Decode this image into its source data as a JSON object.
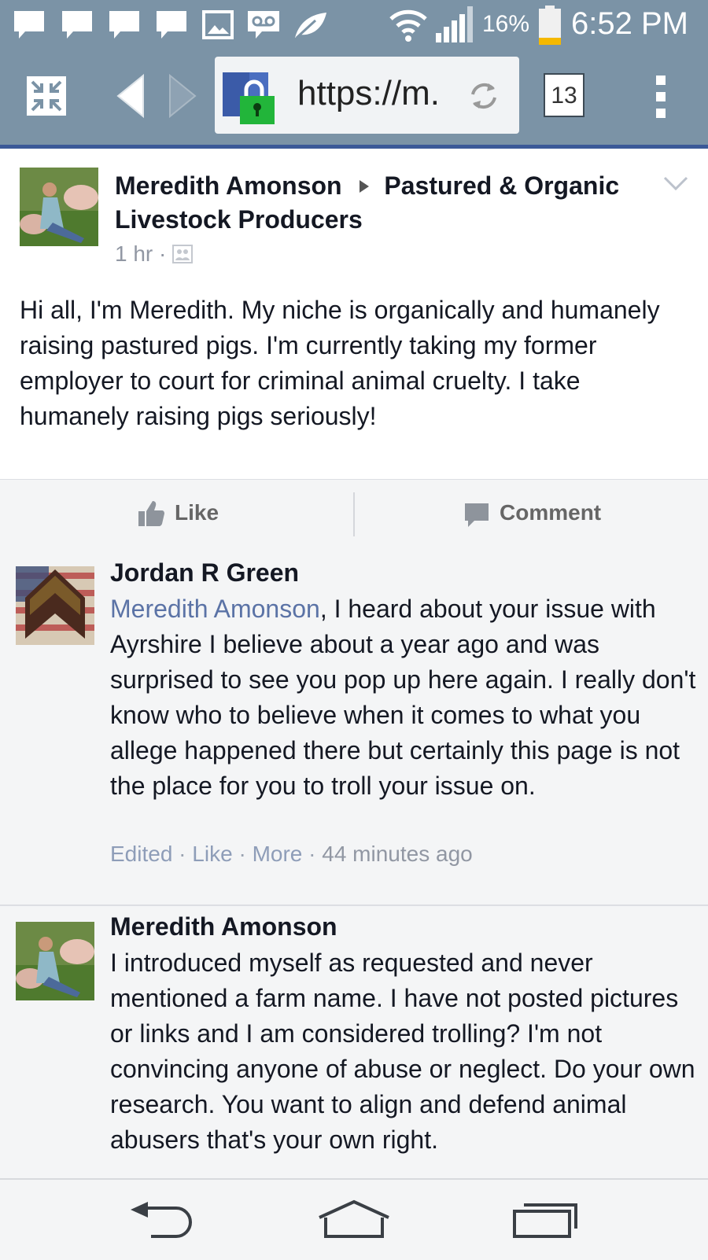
{
  "status_bar": {
    "icons": [
      "message-icon",
      "message-icon",
      "message-icon",
      "message-icon",
      "image-icon",
      "voicemail-icon",
      "leaf-icon",
      "wifi-icon",
      "signal-icon"
    ],
    "battery_percent": "16%",
    "battery_level": 0.16,
    "time": "6:52 PM"
  },
  "browser": {
    "url": "https://m.",
    "tab_count": "13"
  },
  "post": {
    "author": "Meredith Amonson",
    "group": "Pastured & Organic Livestock Producers",
    "time": "1 hr",
    "body": "Hi all, I'm Meredith. My niche is organically and humanely raising pastured pigs. I'm currently taking my former employer to court for criminal animal cruelty. I take humanely raising pigs seriously!"
  },
  "actions": {
    "like": "Like",
    "comment": "Comment"
  },
  "comments": [
    {
      "author": "Jordan R Green",
      "mention": "Meredith Amonson",
      "text": ", I heard about your issue with Ayrshire I believe about a year ago and was surprised to see you pop up here again. I really don't know who to believe when it comes to what you allege happened there but certainly this page is not the place for you to troll your issue on.",
      "edited": "Edited",
      "like": "Like",
      "more": "More",
      "time": "44 minutes ago"
    },
    {
      "author": "Meredith Amonson",
      "text": "I introduced myself as requested and never mentioned a farm name. I have not posted pictures or links and I am considered trolling? I'm not convincing anyone of abuse or neglect. Do your own research. You want to align and defend animal abusers that's your own right."
    }
  ],
  "colors": {
    "chrome": "#7b93a6",
    "facebook_blue": "#3b5998",
    "link": "#5b73a6",
    "lock_green": "#22b53a"
  }
}
